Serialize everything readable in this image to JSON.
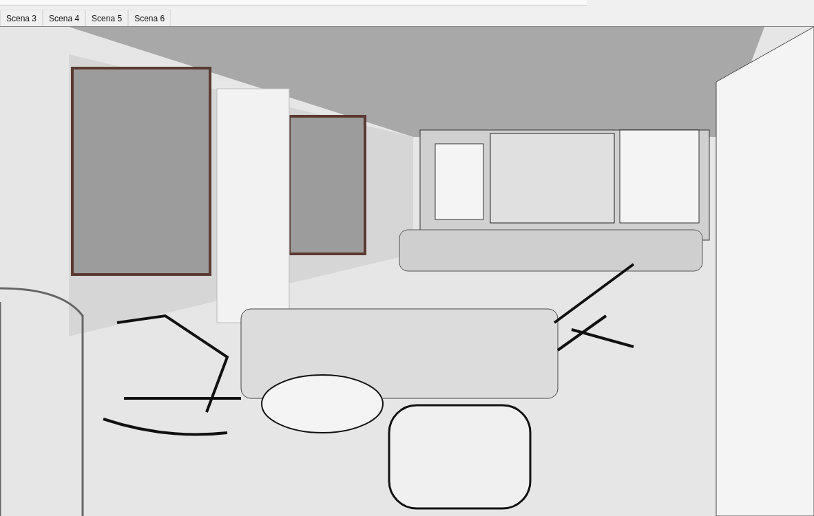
{
  "scene_tabs": [
    {
      "label": "Scena 3",
      "selected": false
    },
    {
      "label": "Scena 4",
      "selected": false
    },
    {
      "label": "Scena 5",
      "selected": false
    },
    {
      "label": "Scena 6",
      "selected": false
    }
  ]
}
